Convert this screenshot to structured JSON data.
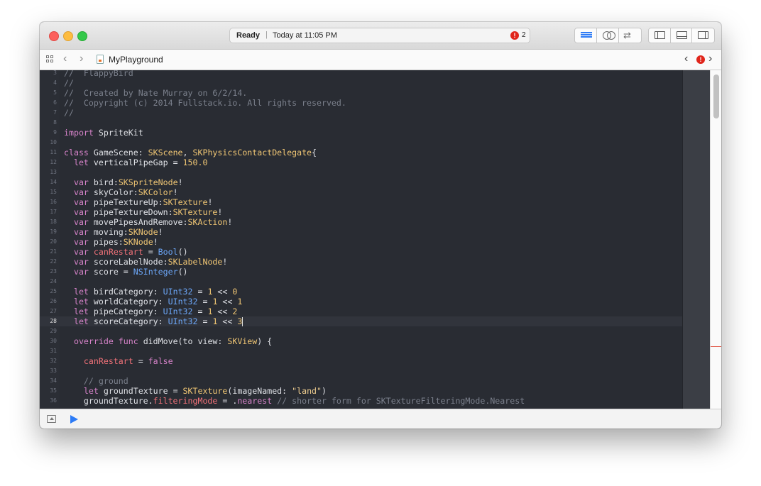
{
  "toolbar": {
    "status": "Ready",
    "separator": "|",
    "timestamp": "Today at 11:05 PM",
    "error_count": "2",
    "error_icon_glyph": "!"
  },
  "jumpbar": {
    "file_name": "MyPlayground",
    "back_glyph": "‹",
    "forward_glyph": "›",
    "prev_issue_glyph": "‹",
    "next_issue_glyph": "›",
    "issue_glyph": "!"
  },
  "editor": {
    "current_line": "28",
    "lines": [
      {
        "n": "3",
        "text": "//  FlappyBird"
      },
      {
        "n": "4",
        "text": "//"
      },
      {
        "n": "5",
        "text": "//  Created by Nate Murray on 6/2/14."
      },
      {
        "n": "6",
        "text": "//  Copyright (c) 2014 Fullstack.io. All rights reserved."
      },
      {
        "n": "7",
        "text": "//"
      },
      {
        "n": "8",
        "text": ""
      },
      {
        "n": "9",
        "text": "import SpriteKit"
      },
      {
        "n": "10",
        "text": ""
      },
      {
        "n": "11",
        "text": "class GameScene: SKScene, SKPhysicsContactDelegate{"
      },
      {
        "n": "12",
        "text": "  let verticalPipeGap = 150.0"
      },
      {
        "n": "13",
        "text": ""
      },
      {
        "n": "14",
        "text": "  var bird:SKSpriteNode!"
      },
      {
        "n": "15",
        "text": "  var skyColor:SKColor!"
      },
      {
        "n": "16",
        "text": "  var pipeTextureUp:SKTexture!"
      },
      {
        "n": "17",
        "text": "  var pipeTextureDown:SKTexture!"
      },
      {
        "n": "18",
        "text": "  var movePipesAndRemove:SKAction!"
      },
      {
        "n": "19",
        "text": "  var moving:SKNode!"
      },
      {
        "n": "20",
        "text": "  var pipes:SKNode!"
      },
      {
        "n": "21",
        "text": "  var canRestart = Bool()"
      },
      {
        "n": "22",
        "text": "  var scoreLabelNode:SKLabelNode!"
      },
      {
        "n": "23",
        "text": "  var score = NSInteger()"
      },
      {
        "n": "24",
        "text": ""
      },
      {
        "n": "25",
        "text": "  let birdCategory: UInt32 = 1 << 0"
      },
      {
        "n": "26",
        "text": "  let worldCategory: UInt32 = 1 << 1"
      },
      {
        "n": "27",
        "text": "  let pipeCategory: UInt32 = 1 << 2"
      },
      {
        "n": "28",
        "text": "  let scoreCategory: UInt32 = 1 << 3"
      },
      {
        "n": "29",
        "text": ""
      },
      {
        "n": "30",
        "text": "  override func didMove(to view: SKView) {"
      },
      {
        "n": "31",
        "text": ""
      },
      {
        "n": "32",
        "text": "    canRestart = false"
      },
      {
        "n": "33",
        "text": ""
      },
      {
        "n": "34",
        "text": "    // ground"
      },
      {
        "n": "35",
        "text": "    let groundTexture = SKTexture(imageNamed: \"land\")"
      },
      {
        "n": "36",
        "text": "    groundTexture.filteringMode = .nearest // shorter form for SKTextureFilteringMode.Nearest"
      }
    ]
  },
  "colors": {
    "editor_background": "#292c33",
    "keyword": "#d683c9",
    "type": "#f0c674",
    "builtin_type": "#6ca6f7",
    "number": "#f0c674",
    "comment": "#7b808c",
    "string": "#eecd8f",
    "property": "#f07178",
    "run_button": "#2c7bf6",
    "error_badge": "#e0251b"
  },
  "icons": {
    "close": "close-button",
    "minimize": "minimize-button",
    "zoom": "zoom-button",
    "standard_editor": "standard-editor-icon",
    "assistant_editor": "assistant-editor-icon",
    "version_editor": "version-editor-icon",
    "navigator": "navigator-panel-icon",
    "debug": "debug-area-icon",
    "utilities": "utilities-panel-icon",
    "run": "play-icon"
  }
}
